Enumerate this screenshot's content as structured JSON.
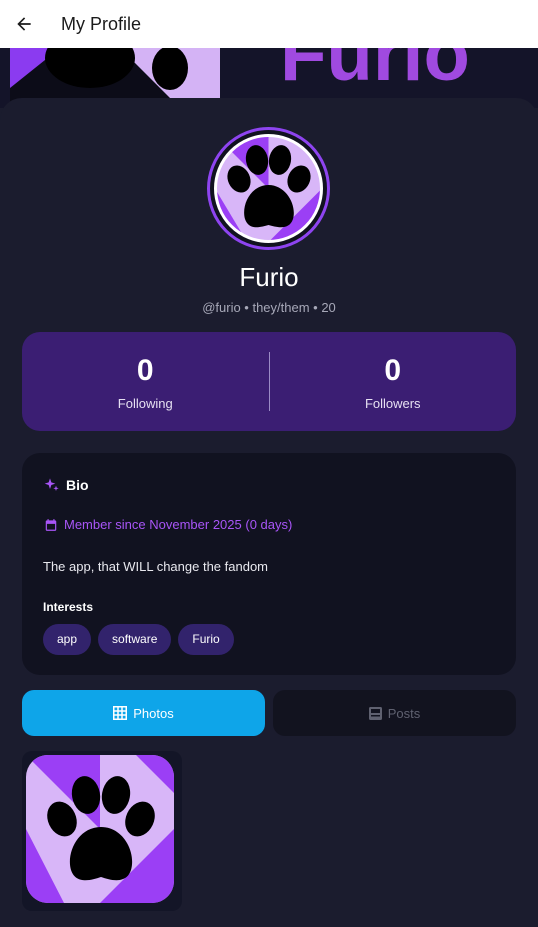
{
  "appbar": {
    "title": "My Profile",
    "back_icon": "arrow-left-icon"
  },
  "banner": {
    "text": "Furio"
  },
  "profile": {
    "name": "Furio",
    "handle_line": "@furio • they/them • 20"
  },
  "stats": [
    {
      "value": "0",
      "label": "Following"
    },
    {
      "value": "0",
      "label": "Followers"
    }
  ],
  "bio": {
    "title": "Bio",
    "member_since": "Member since November 2025 (0 days)",
    "text": "The app, that WILL change the fandom",
    "interests_label": "Interests",
    "interests": [
      "app",
      "software",
      "Furio"
    ]
  },
  "tabs": [
    {
      "label": "Photos",
      "icon": "grid-icon",
      "active": true
    },
    {
      "label": "Posts",
      "icon": "posts-icon",
      "active": false
    }
  ],
  "colors": {
    "background": "#1b1c2e",
    "stats_card": "#3b1e73",
    "accent_purple": "#a855f7",
    "active_tab": "#0ea5e9"
  }
}
